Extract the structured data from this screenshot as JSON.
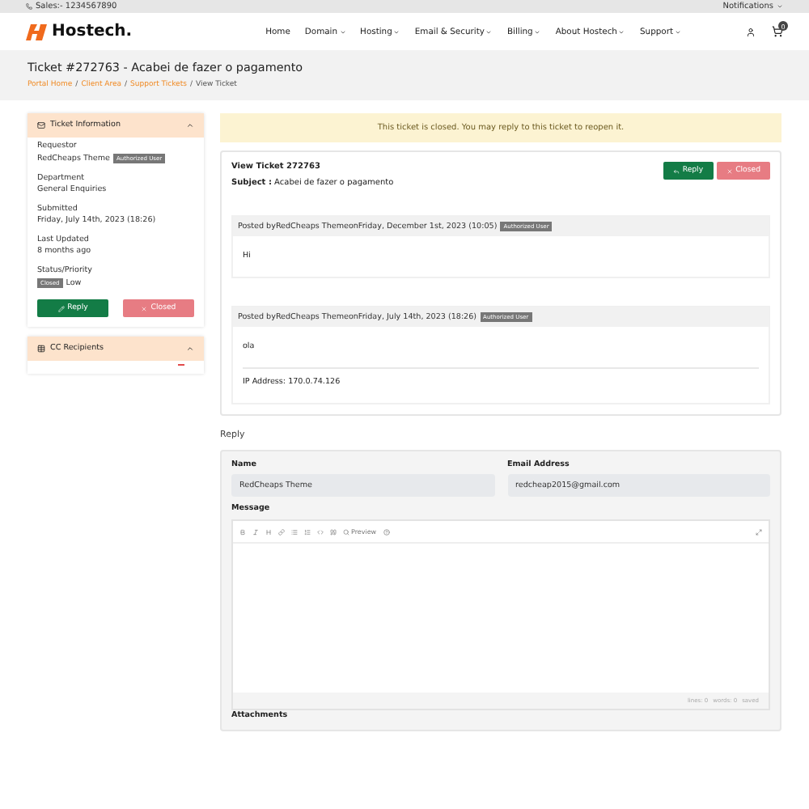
{
  "topbar": {
    "sales": "Sales:- 1234567890",
    "notifications": "Notifications"
  },
  "header": {
    "logo": "Hostech.",
    "nav": [
      {
        "label": "Home",
        "dropdown": false
      },
      {
        "label": "Domain",
        "dropdown": true
      },
      {
        "label": "Hosting",
        "dropdown": true
      },
      {
        "label": "Email & Security",
        "dropdown": true
      },
      {
        "label": "Billing",
        "dropdown": true
      },
      {
        "label": "About Hostech",
        "dropdown": true
      },
      {
        "label": "Support",
        "dropdown": true
      }
    ],
    "cart_count": "0"
  },
  "page": {
    "title": "Ticket #272763 - Acabei de fazer o pagamento",
    "separator": "/",
    "breadcrumb": [
      {
        "label": "Portal Home",
        "link": true
      },
      {
        "label": "Client Area",
        "link": true
      },
      {
        "label": "Support Tickets",
        "link": true
      },
      {
        "label": "View Ticket",
        "link": false
      }
    ]
  },
  "sidebar": {
    "ticket_info": {
      "title": "Ticket Information",
      "expanded": true,
      "fields": [
        {
          "label": "Requestor",
          "value": "RedCheaps Theme",
          "badge": "Authorized User"
        },
        {
          "label": "Department",
          "value": "General Enquiries"
        },
        {
          "label": "Submitted",
          "value": "Friday, July 14th, 2023 (18:26)"
        },
        {
          "label": "Last Updated",
          "value": "8 months ago"
        },
        {
          "label": "Status/Priority",
          "status": "Closed",
          "value": "Low"
        }
      ],
      "buttons": [
        {
          "label": "Reply",
          "kind": "reply"
        },
        {
          "label": "Closed",
          "kind": "closed"
        }
      ]
    },
    "cc": {
      "title": "CC Recipients",
      "expanded": true
    }
  },
  "alert": "This ticket is closed. You may reply to this ticket to reopen it.",
  "ticket": {
    "heading": "View Ticket 272763",
    "subject_label": "Subject :",
    "subject": "Acabei de fazer o pagamento",
    "buttons": [
      {
        "label": "Reply",
        "kind": "reply"
      },
      {
        "label": "Closed",
        "kind": "closed"
      }
    ],
    "posts": [
      {
        "header": "Posted byRedCheaps ThemeonFriday, December 1st, 2023 (10:05)",
        "badge": "Authorized User",
        "body": "Hi"
      },
      {
        "header": "Posted byRedCheaps ThemeonFriday, July 14th, 2023 (18:26)",
        "badge": "Authorized User",
        "body": "ola",
        "ip": "IP Address: 170.0.74.126"
      }
    ]
  },
  "reply": {
    "title": "Reply",
    "name_label": "Name",
    "name": "RedCheaps Theme",
    "email_label": "Email Address",
    "email": "redcheap2015@gmail.com",
    "message_label": "Message",
    "preview": "Preview",
    "status": [
      "lines: 0",
      "words: 0",
      "saved"
    ],
    "attachments_label": "Attachments"
  }
}
